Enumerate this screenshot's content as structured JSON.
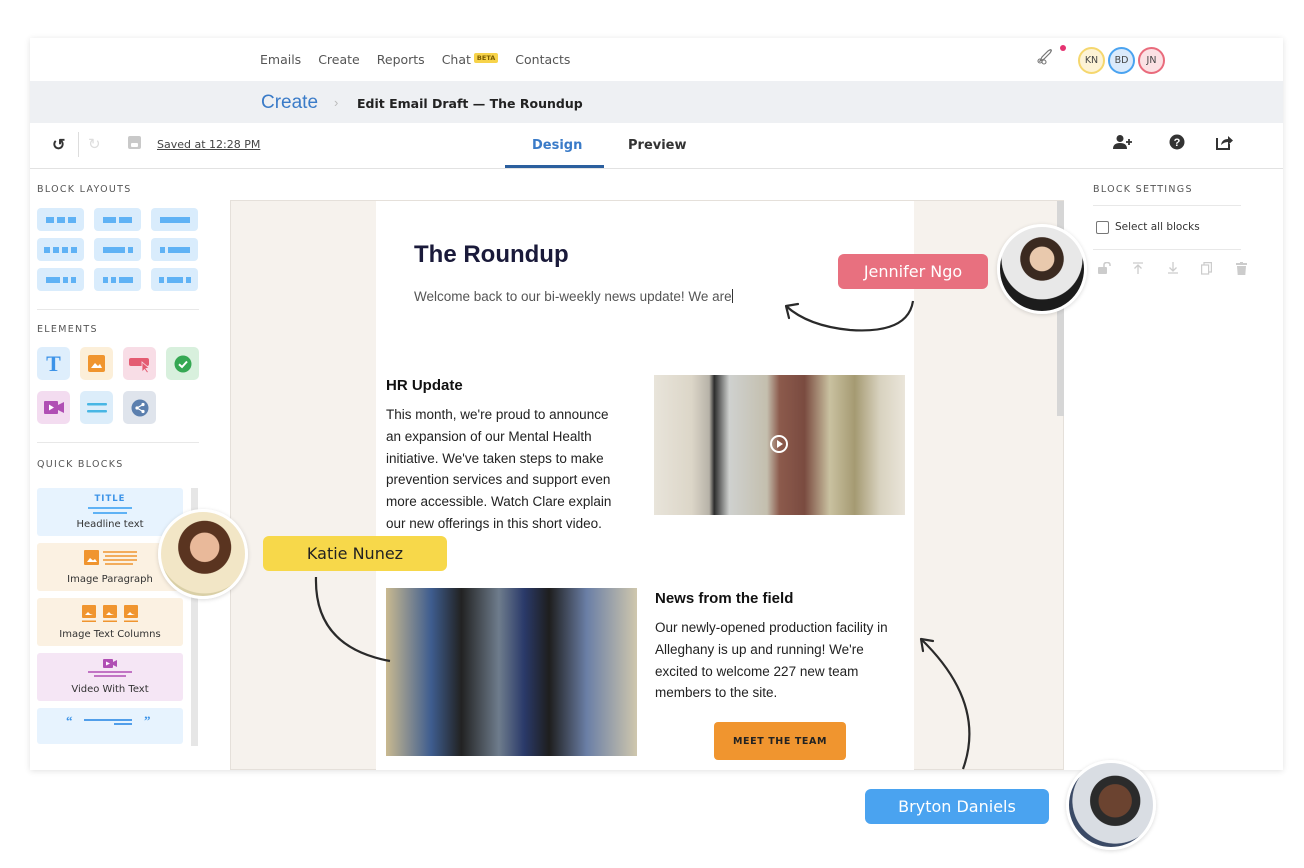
{
  "nav": {
    "links": [
      "Emails",
      "Create",
      "Reports",
      "Chat",
      "Contacts"
    ],
    "chat_badge": "BETA",
    "notification_icon": "rocket-icon",
    "collaborators": [
      {
        "initials": "KN",
        "border": "#f5d76e",
        "fill": "#fdf3d6"
      },
      {
        "initials": "BD",
        "border": "#4aa3f0",
        "fill": "#dbeafb"
      },
      {
        "initials": "JN",
        "border": "#e96b7c",
        "fill": "#fbe1e4"
      }
    ]
  },
  "breadcrumb": {
    "root": "Create",
    "separator": "›",
    "current": "Edit Email Draft — The Roundup"
  },
  "toolbar": {
    "saved_status": "Saved at 12:28 PM",
    "tabs": [
      {
        "label": "Design",
        "active": true
      },
      {
        "label": "Preview",
        "active": false
      }
    ],
    "right_icons": [
      "add-user-icon",
      "help-icon",
      "share-icon"
    ]
  },
  "left_panel": {
    "block_layouts_title": "BLOCK LAYOUTS",
    "elements_title": "ELEMENTS",
    "elements": [
      "text",
      "image",
      "button",
      "checkmark",
      "video",
      "divider",
      "social-share"
    ],
    "quick_blocks_title": "QUICK BLOCKS",
    "quick_blocks": [
      {
        "label": "Headline text",
        "badge": "TITLE",
        "color": "#e7f3fe"
      },
      {
        "label": "Image Paragraph",
        "color": "#fbf1e2"
      },
      {
        "label": "Image Text Columns",
        "color": "#fbf1e2"
      },
      {
        "label": "Video With Text",
        "color": "#f5e6f5"
      },
      {
        "label": "Quote",
        "color": "#e7f3fe"
      }
    ]
  },
  "email": {
    "title": "The Roundup",
    "intro": "Welcome back to our bi-weekly news update! We are",
    "hr_heading": "HR Update",
    "hr_lines": [
      "This month, we're proud to announce",
      "an expansion of our Mental Health",
      "initiative. We've taken steps to make",
      "prevention services and support even",
      "more accessible. Watch Clare explain",
      "our new offerings in this short video."
    ],
    "field_heading": "News from the field",
    "field_lines": [
      "Our newly-opened production facility in",
      "Alleghany is up and running! We're",
      "excited to welcome 227 new team",
      "members to the site."
    ],
    "cta_label": "MEET THE TEAM"
  },
  "right_panel": {
    "title": "BLOCK SETTINGS",
    "select_all_label": "Select all blocks",
    "select_all_checked": false,
    "icons": [
      "unlock-icon",
      "move-top-icon",
      "move-bottom-icon",
      "duplicate-icon",
      "delete-icon"
    ]
  },
  "collaborator_tags": {
    "jennifer": {
      "name": "Jennifer Ngo",
      "color": "#e8707f"
    },
    "katie": {
      "name": "Katie Nunez",
      "color": "#f7d84a"
    },
    "bryton": {
      "name": "Bryton Daniels",
      "color": "#4aa3f0"
    }
  }
}
